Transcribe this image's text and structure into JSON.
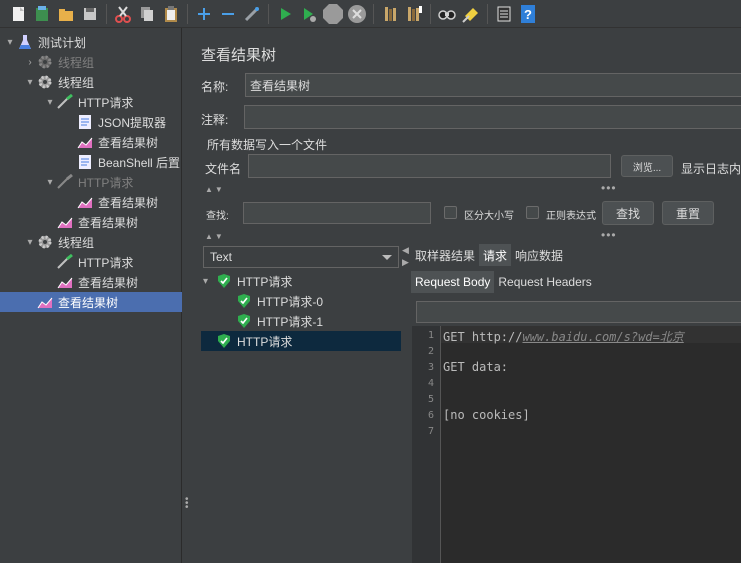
{
  "toolbar": {
    "buttons": [
      {
        "name": "new-icon",
        "color": "#f0f0f0"
      },
      {
        "name": "templates-icon",
        "color": "#3d8f4f"
      },
      {
        "name": "open-icon",
        "color": "#e8b04a"
      },
      {
        "name": "save-icon",
        "color": "#c8c8c8"
      },
      {
        "name": "cut-icon",
        "color": "#e05050"
      },
      {
        "name": "copy-icon",
        "color": "#d0d0d0"
      },
      {
        "name": "paste-icon",
        "color": "#d8c89a"
      },
      {
        "name": "expand-icon",
        "color": "#4a9fe8"
      },
      {
        "name": "collapse-icon",
        "color": "#4a9fe8"
      },
      {
        "name": "toggle-icon",
        "color": "#9aa0a6"
      },
      {
        "name": "start-icon",
        "color": "#2fae4f"
      },
      {
        "name": "start-no-pauses-icon",
        "color": "#2fae4f"
      },
      {
        "name": "stop-icon",
        "color": "#9a9a9a"
      },
      {
        "name": "shutdown-icon",
        "color": "#9a9a9a"
      },
      {
        "name": "clear-icon",
        "color": "#c9a76a"
      },
      {
        "name": "clear-all-icon",
        "color": "#c9a76a"
      },
      {
        "name": "search-icon",
        "color": "#d0d0d0"
      },
      {
        "name": "reset-search-icon",
        "color": "#f0d040"
      },
      {
        "name": "function-helper-icon",
        "color": "#e0e0e0"
      },
      {
        "name": "help-icon",
        "color": "#2f7fd8"
      }
    ]
  },
  "tree": {
    "items": [
      {
        "label": "测试计划",
        "indent": 0,
        "arrow": "▾",
        "icon": "flask-icon",
        "disabled": false
      },
      {
        "label": "线程组",
        "indent": 1,
        "arrow": "›",
        "icon": "gear-icon",
        "disabled": true
      },
      {
        "label": "线程组",
        "indent": 1,
        "arrow": "▾",
        "icon": "gear-icon",
        "disabled": false
      },
      {
        "label": "HTTP请求",
        "indent": 2,
        "arrow": "▾",
        "icon": "pipette-icon",
        "disabled": false
      },
      {
        "label": "JSON提取器",
        "indent": 3,
        "arrow": "",
        "icon": "document-icon",
        "disabled": false
      },
      {
        "label": "查看结果树",
        "indent": 3,
        "arrow": "",
        "icon": "chart-icon",
        "disabled": false
      },
      {
        "label": "BeanShell 后置",
        "indent": 3,
        "arrow": "",
        "icon": "document-icon",
        "disabled": false
      },
      {
        "label": "HTTP请求",
        "indent": 2,
        "arrow": "▾",
        "icon": "pipette-icon",
        "disabled": true
      },
      {
        "label": "查看结果树",
        "indent": 3,
        "arrow": "",
        "icon": "chart-icon",
        "disabled": false
      },
      {
        "label": "查看结果树",
        "indent": 2,
        "arrow": "",
        "icon": "chart-icon",
        "disabled": false
      },
      {
        "label": "线程组",
        "indent": 1,
        "arrow": "▾",
        "icon": "gear-icon",
        "disabled": false
      },
      {
        "label": "HTTP请求",
        "indent": 2,
        "arrow": "",
        "icon": "pipette-icon",
        "disabled": false
      },
      {
        "label": "查看结果树",
        "indent": 2,
        "arrow": "",
        "icon": "chart-icon",
        "disabled": false
      },
      {
        "label": "查看结果树",
        "indent": 1,
        "arrow": "",
        "icon": "chart-icon",
        "disabled": false,
        "selected": true
      }
    ]
  },
  "panel": {
    "title": "查看结果树",
    "name_label": "名称:",
    "name_value": "查看结果树",
    "comment_label": "注释:",
    "comment_value": "",
    "write_file_label": "所有数据写入一个文件",
    "filename_label": "文件名",
    "filename_value": "",
    "browse_button": "浏览...",
    "log_content_label": "显示日志内",
    "search_label": "查找:",
    "search_value": "",
    "case_sensitive_label": "区分大小写",
    "regex_label": "正则表达式",
    "find_button": "查找",
    "reset_button": "重置"
  },
  "results": {
    "renderer_selected": "Text",
    "items": [
      {
        "label": "HTTP请求",
        "level": 0,
        "arrow": "▾",
        "selected": false
      },
      {
        "label": "HTTP请求-0",
        "level": 1,
        "arrow": "",
        "selected": false
      },
      {
        "label": "HTTP请求-1",
        "level": 1,
        "arrow": "",
        "selected": false
      },
      {
        "label": "HTTP请求",
        "level": 0,
        "arrow": "",
        "selected": true
      }
    ],
    "tabs": [
      "取样器结果",
      "请求",
      "响应数据"
    ],
    "active_tab": 1,
    "subtabs": [
      "Request Body",
      "Request Headers"
    ],
    "active_subtab": 0,
    "editor_lines": [
      {
        "num": "1",
        "prefix": "GET http://",
        "url": "www.baidu.com/s?wd=北京"
      },
      {
        "num": "2",
        "prefix": "",
        "url": ""
      },
      {
        "num": "3",
        "prefix": "GET data:",
        "url": ""
      },
      {
        "num": "4",
        "prefix": "",
        "url": ""
      },
      {
        "num": "5",
        "prefix": "",
        "url": ""
      },
      {
        "num": "6",
        "prefix": "[no cookies]",
        "url": ""
      },
      {
        "num": "7",
        "prefix": "",
        "url": ""
      }
    ]
  },
  "colors": {
    "selection": "#4b6eaf",
    "shield_green": "#2fae4f",
    "result_selected_bg": "#0d293e"
  }
}
